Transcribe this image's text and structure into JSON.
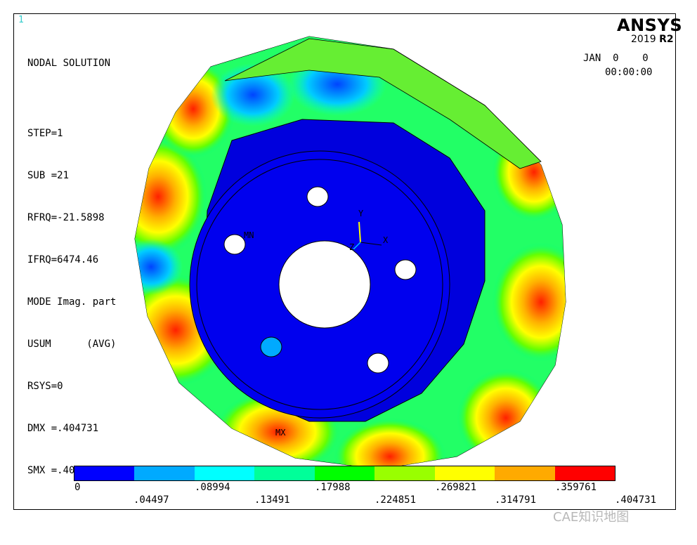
{
  "window_number": "1",
  "info_lines": [
    "NODAL SOLUTION",
    "",
    "STEP=1",
    "SUB =21",
    "RFRQ=-21.5898",
    "IFRQ=6474.46",
    "MODE Imag. part",
    "USUM      (AVG)",
    "RSYS=0",
    "DMX =.404731",
    "SMX =.404731"
  ],
  "logo": "ANSYS",
  "version_year": "2019",
  "version_rel": "R2",
  "date": "JAN  0    0",
  "time": "00:00:00",
  "labels": {
    "mn": "MN",
    "mx": "MX",
    "axis_y": "Y",
    "axis_x": "X",
    "axis_z": "Z"
  },
  "legend": {
    "colors": [
      "#0000ff",
      "#00aaff",
      "#00ffff",
      "#00ff99",
      "#00ff00",
      "#99ff00",
      "#ffff00",
      "#ffaa00",
      "#ff0000"
    ],
    "ticks_top": [
      "0",
      ".08994",
      ".17988",
      ".269821",
      ".359761"
    ],
    "ticks_bottom": [
      ".04497",
      ".13491",
      ".224851",
      ".314791",
      ".404731"
    ]
  },
  "watermark": "CAE知识地图"
}
